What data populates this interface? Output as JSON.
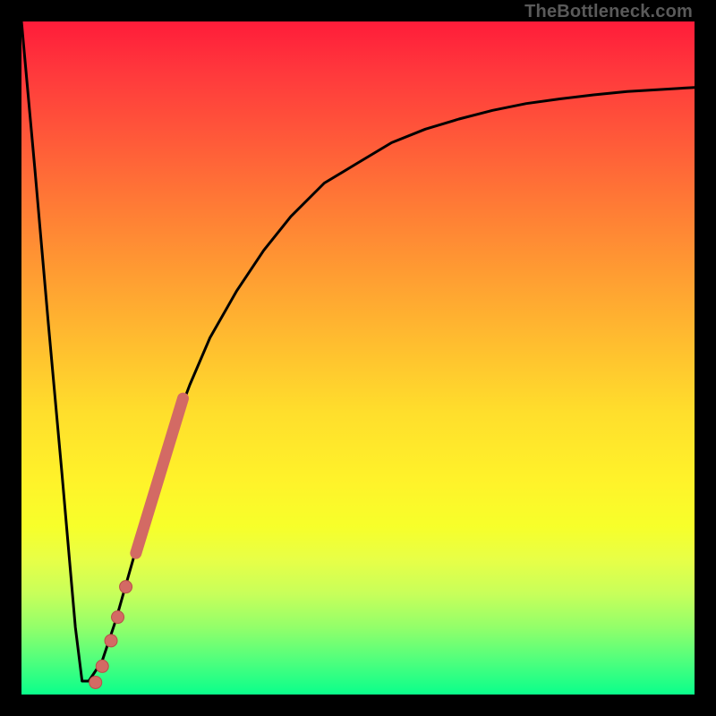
{
  "watermark": "TheBottleneck.com",
  "colors": {
    "frame": "#000000",
    "curve": "#000000",
    "marker_fill": "#d36a64",
    "marker_stroke": "#b94f49"
  },
  "chart_data": {
    "type": "line",
    "title": "",
    "xlabel": "",
    "ylabel": "",
    "xlim": [
      0,
      100
    ],
    "ylim": [
      0,
      100
    ],
    "grid": false,
    "legend": false,
    "notes": "No numeric axes shown. Values estimated from pixel positions. y=0 at bottom (green) represents minimum bottleneck; y=100 at top (red) is maximum. Curve dips from top-left to ~0 near x≈9 then rises asymptotically toward ~90 at right edge.",
    "series": [
      {
        "name": "bottleneck-curve",
        "x": [
          0,
          2,
          4,
          6,
          8,
          9,
          10,
          12,
          14,
          16,
          18,
          20,
          22,
          25,
          28,
          32,
          36,
          40,
          45,
          50,
          55,
          60,
          65,
          70,
          75,
          80,
          85,
          90,
          95,
          100
        ],
        "y": [
          100,
          78,
          55,
          33,
          10,
          2,
          2,
          5,
          11,
          18,
          25,
          32,
          38,
          46,
          53,
          60,
          66,
          71,
          76,
          79,
          82,
          84,
          85.5,
          86.8,
          87.8,
          88.5,
          89.1,
          89.6,
          89.9,
          90.2
        ]
      }
    ],
    "markers": [
      {
        "name": "segment-thick",
        "type": "segment",
        "x0": 17,
        "y0": 21,
        "x1": 24,
        "y1": 44
      },
      {
        "name": "dot-1",
        "type": "dot",
        "x": 15.5,
        "y": 16
      },
      {
        "name": "dot-2",
        "type": "dot",
        "x": 14.3,
        "y": 11.5
      },
      {
        "name": "dot-3",
        "type": "dot",
        "x": 13.3,
        "y": 8
      },
      {
        "name": "dot-4",
        "type": "dot",
        "x": 12.0,
        "y": 4.2
      },
      {
        "name": "dot-5",
        "type": "dot",
        "x": 11.0,
        "y": 1.8
      }
    ]
  }
}
